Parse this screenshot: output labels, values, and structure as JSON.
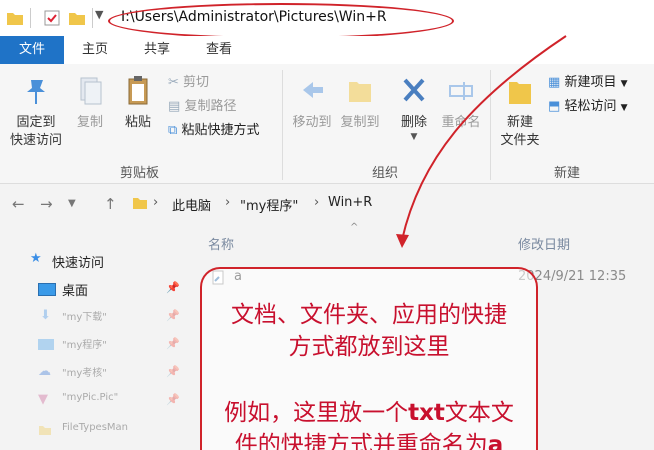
{
  "address_path": "I:\\Users\\Administrator\\Pictures\\Win+R",
  "tabs": [
    "文件",
    "主页",
    "共享",
    "查看"
  ],
  "ribbon": {
    "pin_line1": "固定到",
    "pin_line2": "快速访问",
    "copy": "复制",
    "paste": "粘贴",
    "cut": "剪切",
    "copy_path": "复制路径",
    "paste_shortcut": "粘贴快捷方式",
    "move_to": "移动到",
    "copy_to": "复制到",
    "delete": "删除",
    "rename": "重命名",
    "new_folder_line1": "新建",
    "new_folder_line2": "文件夹",
    "new_item": "新建项目",
    "easy_access": "轻松访问",
    "group_clipboard": "剪贴板",
    "group_organize": "组织",
    "group_new": "新建"
  },
  "breadcrumb": [
    "此电脑",
    "\"my程序\"",
    "Win+R"
  ],
  "columns": {
    "name": "名称",
    "modified": "修改日期"
  },
  "file": {
    "name": "a",
    "modified": "2024/9/21 12:35"
  },
  "nav": {
    "quick_access": "快速访问",
    "desktop": "桌面",
    "item1": "\"my下载\"",
    "item2": "\"my程序\"",
    "item3": "\"my考核\"",
    "item4": "\"myPic.Pic\"",
    "item5": "FileTypesMan"
  },
  "annotation": {
    "line1": "文档、文件夹、应用的快捷",
    "line2": "方式都放到这里",
    "line3_pre": "例如，这里放一个",
    "line3_bold": "txt",
    "line3_post": "文本文",
    "line4_pre": "件的快捷方式并重命名为",
    "line4_bold": "a"
  },
  "colors": {
    "accent": "#1f73c7",
    "annotation": "#c8102e",
    "folder": "#f0c64a"
  }
}
